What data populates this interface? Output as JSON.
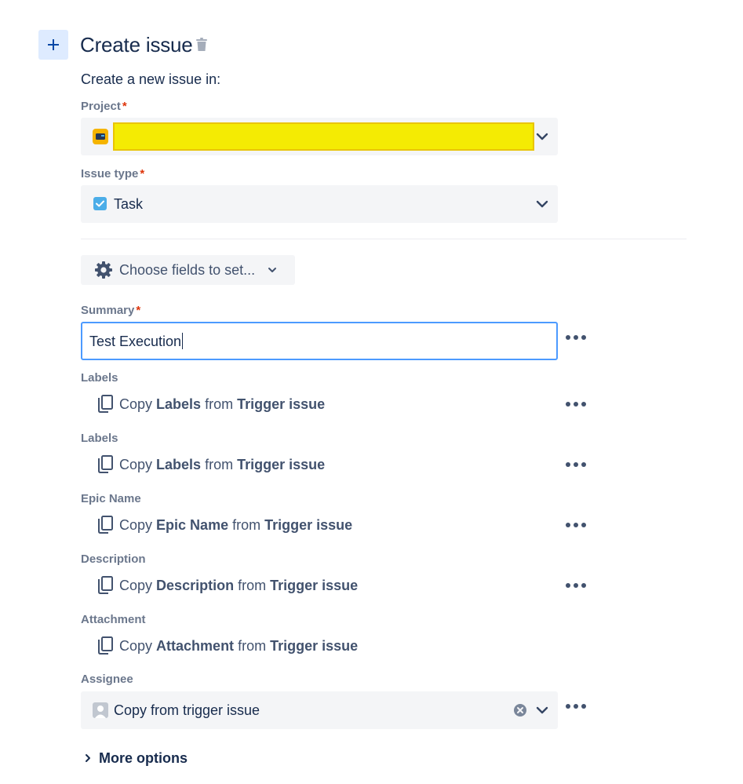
{
  "header": {
    "title": "Create issue",
    "subtitle": "Create a new issue in:"
  },
  "project": {
    "label": "Project",
    "required_mark": "*"
  },
  "issue_type": {
    "label": "Issue type",
    "required_mark": "*",
    "value": "Task"
  },
  "choose_fields": {
    "label": "Choose fields to set..."
  },
  "summary": {
    "label": "Summary",
    "required_mark": "*",
    "value": "Test Execution"
  },
  "copy_fields": [
    {
      "label": "Labels",
      "copy": "Copy",
      "field": "Labels",
      "from": "from",
      "source": "Trigger issue"
    },
    {
      "label": "Labels",
      "copy": "Copy",
      "field": "Labels",
      "from": "from",
      "source": "Trigger issue"
    },
    {
      "label": "Epic Name",
      "copy": "Copy",
      "field": "Epic Name",
      "from": "from",
      "source": "Trigger issue"
    },
    {
      "label": "Description",
      "copy": "Copy",
      "field": "Description",
      "from": "from",
      "source": "Trigger issue"
    },
    {
      "label": "Attachment",
      "copy": "Copy",
      "field": "Attachment",
      "from": "from",
      "source": "Trigger issue"
    }
  ],
  "assignee": {
    "label": "Assignee",
    "value": "Copy from trigger issue"
  },
  "more_options": {
    "label": "More options"
  },
  "colors": {
    "accent": "#0052CC",
    "focus_border": "#4C9AFF",
    "required": "#DE350B",
    "highlight": "#F4EB03",
    "field_bg": "#F4F5F7",
    "label_text": "#6B778C"
  }
}
